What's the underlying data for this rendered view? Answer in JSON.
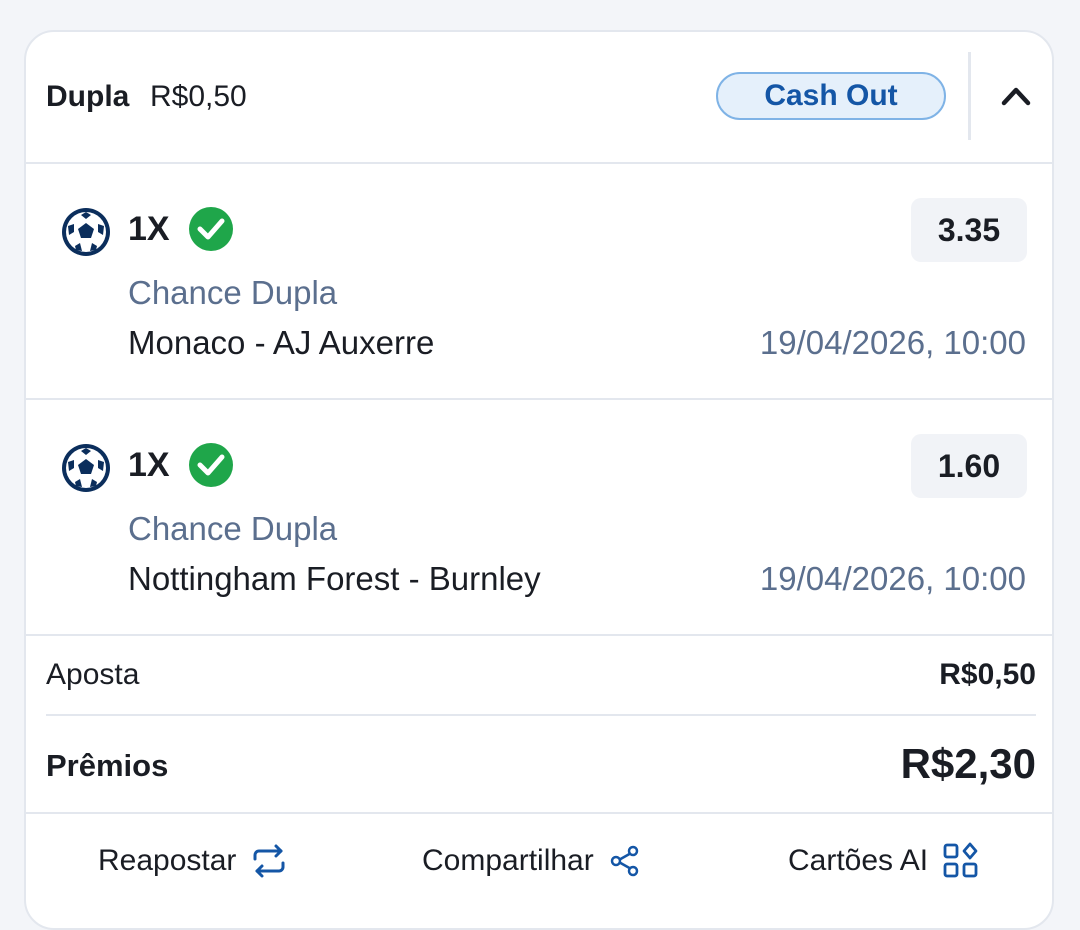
{
  "header": {
    "bet_type": "Dupla",
    "stake": "R$0,50",
    "cashout_label": "Cash Out",
    "collapse_icon": "chevron-up-icon"
  },
  "selections": [
    {
      "sport_icon": "soccer-ball-icon",
      "pick": "1X",
      "status_icon": "check-circle-icon",
      "odds": "3.35",
      "market": "Chance Dupla",
      "event": "Monaco - AJ Auxerre",
      "datetime": "19/04/2026, 10:00"
    },
    {
      "sport_icon": "soccer-ball-icon",
      "pick": "1X",
      "status_icon": "check-circle-icon",
      "odds": "1.60",
      "market": "Chance Dupla",
      "event": "Nottingham Forest - Burnley",
      "datetime": "19/04/2026, 10:00"
    }
  ],
  "summary": {
    "stake_label": "Aposta",
    "stake_value": "R$0,50",
    "prize_label": "Prêmios",
    "prize_value": "R$2,30"
  },
  "footer": {
    "rebet_label": "Reapostar",
    "share_label": "Compartilhar",
    "cards_label": "Cartões AI"
  },
  "colors": {
    "accent_blue": "#1456a6",
    "cashout_bg": "#e5f0fb",
    "success_green": "#1fa64a",
    "muted_text": "#5b6f8e",
    "ball_navy": "#0b2e5c"
  }
}
